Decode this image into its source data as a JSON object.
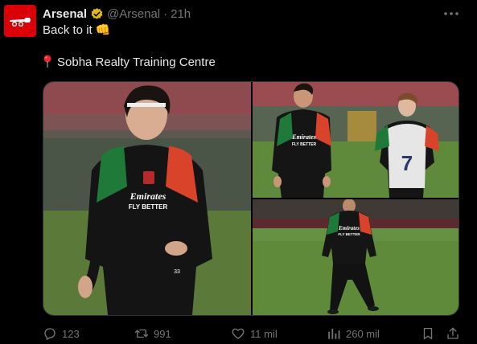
{
  "tweet": {
    "author_name": "Arsenal",
    "handle": "@Arsenal",
    "separator": "·",
    "time": "21h",
    "text_line1": "Back to it 👊",
    "location_text": "Sobha Realty Training Centre"
  },
  "media": {
    "photo1_sponsor": "Emirates",
    "photo1_sponsor_sub": "FLY BETTER",
    "photo1_number": "33",
    "photo2_sponsor": "Emirates",
    "photo2_sponsor_sub": "FLY BETTER",
    "photo2_bib_number": "7",
    "photo3_sponsor": "Emirates",
    "photo3_sponsor_sub": "FLY BETTER"
  },
  "actions": {
    "replies": "123",
    "reposts": "991",
    "likes": "11 mil",
    "views": "260 mil"
  },
  "colors": {
    "brand_red": "#db0007",
    "verified_gold": "#e2b719",
    "muted": "#71767b"
  },
  "icons": {
    "avatar": "arsenal-cannon-logo",
    "verified": "verified-badge-icon",
    "more": "more-icon",
    "pin": "pin-icon",
    "reply": "reply-icon",
    "repost": "repost-icon",
    "like": "heart-icon",
    "views": "views-icon",
    "bookmark": "bookmark-icon",
    "share": "share-icon"
  }
}
